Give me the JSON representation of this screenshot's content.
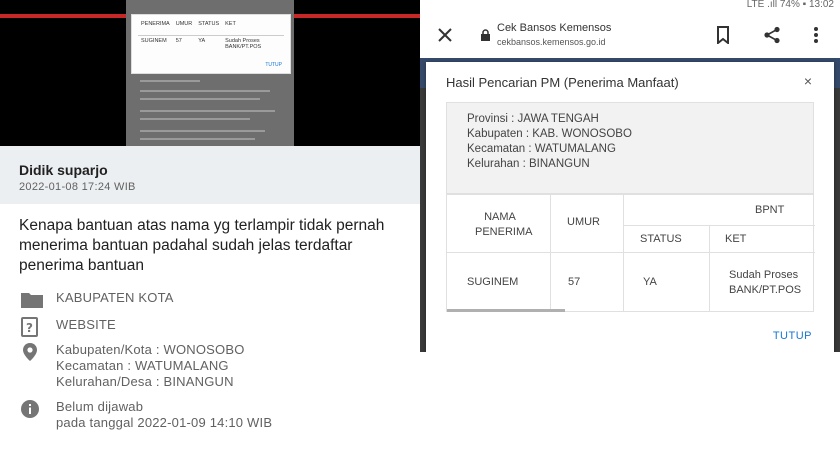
{
  "left": {
    "thumbnail": {
      "headers": [
        "PENERIMA",
        "UMUR",
        "STATUS",
        "KET"
      ],
      "row": [
        "SUGINEM",
        "57",
        "YA",
        "Sudah Proses BANK/PT.POS"
      ],
      "close_label": "TUTUP"
    },
    "author": {
      "name": "Didik suparjo",
      "date": "2022-01-08 17:24 WIB"
    },
    "complaint": "Kenapa bantuan atas nama yg terlampir tidak pernah menerima bantuan padahal sudah jelas terdaftar penerima bantuan",
    "category": "KABUPATEN KOTA",
    "channel": "WEBSITE",
    "location": [
      "Kabupaten/Kota : WONOSOBO",
      "Kecamatan : WATUMALANG",
      "Kelurahan/Desa : BINANGUN"
    ],
    "status": {
      "label": "Belum dijawab",
      "date": "pada tanggal 2022-01-09 14:10 WIB"
    }
  },
  "right": {
    "statusbar": "LTE .ıll 74% ▪ 13:02",
    "site": {
      "title": "Cek Bansos Kemensos",
      "url": "cekbansos.kemensos.go.id"
    },
    "dialog": {
      "title": "Hasil Pencarian PM (Penerima Manfaat)",
      "close": "×",
      "location": [
        "Provinsi : JAWA TENGAH",
        "Kabupaten : KAB. WONOSOBO",
        "Kecamatan : WATUMALANG",
        "Kelurahan : BINANGUN"
      ],
      "table": {
        "col_name": "NAMA PENERIMA",
        "col_age": "UMUR",
        "group": "BPNT",
        "col_status": "STATUS",
        "col_ket": "KET",
        "row": {
          "name": "SUGINEM",
          "age": "57",
          "status": "YA",
          "ket": "Sudah Proses BANK/PT.POS"
        }
      },
      "close_button": "TUTUP"
    }
  },
  "colors": {
    "accent": "#1976d2",
    "brand_red": "#c62828",
    "author_bg": "#eceff1"
  }
}
